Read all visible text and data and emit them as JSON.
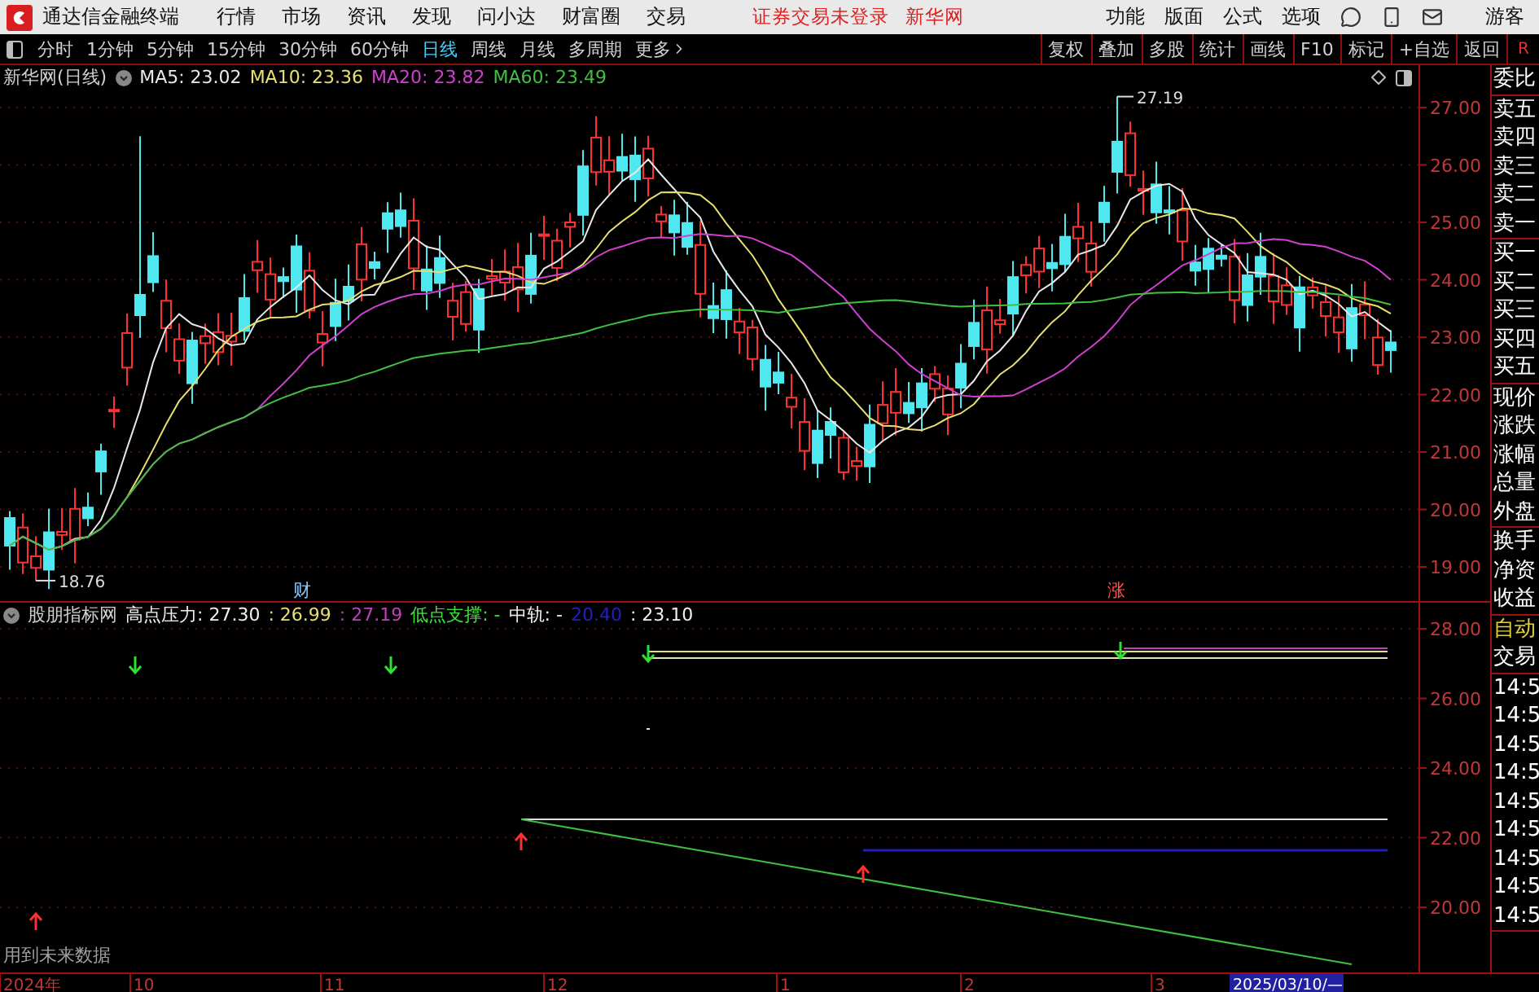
{
  "title_bar": {
    "app_name": "通达信金融终端",
    "menus": [
      "行情",
      "市场",
      "资讯",
      "发现",
      "问小达",
      "财富圈",
      "交易"
    ],
    "status": "证券交易未登录",
    "stock_name": "新华网",
    "right_menus": [
      "功能",
      "版面",
      "公式",
      "选项"
    ],
    "user": "游客"
  },
  "toolbar": {
    "periods": [
      {
        "label": "分时",
        "selected": false
      },
      {
        "label": "1分钟",
        "selected": false
      },
      {
        "label": "5分钟",
        "selected": false
      },
      {
        "label": "15分钟",
        "selected": false
      },
      {
        "label": "30分钟",
        "selected": false
      },
      {
        "label": "60分钟",
        "selected": false
      },
      {
        "label": "日线",
        "selected": true
      },
      {
        "label": "周线",
        "selected": false
      },
      {
        "label": "月线",
        "selected": false
      },
      {
        "label": "多周期",
        "selected": false
      },
      {
        "label": "更多",
        "selected": false
      }
    ],
    "tools": [
      "复权",
      "叠加",
      "多股",
      "统计",
      "画线",
      "F10",
      "标记",
      "+自选",
      "返回"
    ],
    "corner": "R"
  },
  "main_chart": {
    "title": "新华网(日线)",
    "ma": [
      {
        "label": "MA5: 23.02",
        "color": "#e8e8e8"
      },
      {
        "label": "MA10: 23.36",
        "color": "#e6e070"
      },
      {
        "label": "MA20: 23.82",
        "color": "#d040d0"
      },
      {
        "label": "MA60: 23.49",
        "color": "#40c040"
      }
    ],
    "y_ticks": [
      "27.00",
      "26.00",
      "25.00",
      "24.00",
      "23.00",
      "22.00",
      "21.00",
      "20.00",
      "19.00"
    ],
    "high_label": "27.19",
    "low_label": "18.76",
    "markers": [
      {
        "text": "财",
        "color": "#80c8ff"
      },
      {
        "text": "涨",
        "color": "#ff5050"
      }
    ]
  },
  "indicator": {
    "name": "股朋指标网",
    "readouts": [
      {
        "text": "高点压力: 27.30"
      },
      {
        "text": ": 26.99",
        "color": "#e6e070"
      },
      {
        "text": ": 27.19",
        "color": "#c040c0"
      },
      {
        "text": "低点支撑: -",
        "color": "#40e040"
      },
      {
        "text": "中轨: -"
      },
      {
        "text": "20.40",
        "color": "#2020c0"
      },
      {
        "text": ": 23.10"
      }
    ],
    "y_ticks": [
      "28.00",
      "26.00",
      "24.00",
      "22.00",
      "20.00"
    ],
    "note": "用到未来数据"
  },
  "side_panel": {
    "groups": [
      {
        "items": [
          {
            "text": "委比",
            "highlighted": false
          }
        ]
      },
      {
        "items": [
          {
            "text": "卖五",
            "highlighted": false
          },
          {
            "text": "卖四",
            "highlighted": false
          },
          {
            "text": "卖三",
            "highlighted": false
          },
          {
            "text": "卖二",
            "highlighted": false
          },
          {
            "text": "卖一",
            "highlighted": false
          }
        ]
      },
      {
        "items": [
          {
            "text": "买一",
            "highlighted": false
          },
          {
            "text": "买二",
            "highlighted": false
          },
          {
            "text": "买三",
            "highlighted": false
          },
          {
            "text": "买四",
            "highlighted": false
          },
          {
            "text": "买五",
            "highlighted": false
          }
        ]
      },
      {
        "items": [
          {
            "text": "现价",
            "highlighted": false
          },
          {
            "text": "涨跌",
            "highlighted": false
          },
          {
            "text": "涨幅",
            "highlighted": false
          },
          {
            "text": "总量",
            "highlighted": false
          },
          {
            "text": "外盘",
            "highlighted": false
          }
        ]
      },
      {
        "items": [
          {
            "text": "换手",
            "highlighted": false
          },
          {
            "text": "净资",
            "highlighted": false
          },
          {
            "text": "收益",
            "highlighted": false
          }
        ]
      },
      {
        "items": [
          {
            "text": "自动",
            "highlighted": true
          },
          {
            "text": "交易",
            "highlighted": false
          }
        ]
      },
      {
        "items": [
          {
            "text": "14:5",
            "highlighted": false
          },
          {
            "text": "14:5",
            "highlighted": false
          },
          {
            "text": "14:5",
            "highlighted": false
          },
          {
            "text": "14:5",
            "highlighted": false
          },
          {
            "text": "14:5",
            "highlighted": false
          },
          {
            "text": "14:5",
            "highlighted": false
          },
          {
            "text": "14:5",
            "highlighted": false
          },
          {
            "text": "14:5",
            "highlighted": false
          },
          {
            "text": "14:5",
            "highlighted": false
          }
        ]
      }
    ]
  },
  "date_axis": {
    "labels": [
      "2024年",
      "10",
      "11",
      "12",
      "1",
      "2",
      "3"
    ],
    "cursor": "2025/03/10/—"
  }
}
